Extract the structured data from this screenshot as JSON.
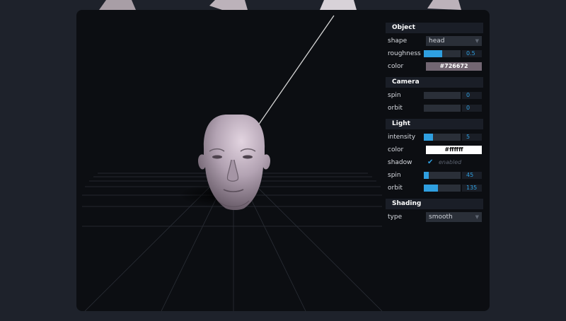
{
  "panel": {
    "object": {
      "title": "Object",
      "shape_label": "shape",
      "shape_value": "head",
      "roughness_label": "roughness",
      "roughness_value": "0.5",
      "roughness_fraction": 0.5,
      "color_label": "color",
      "color_value": "#726672"
    },
    "camera": {
      "title": "Camera",
      "spin_label": "spin",
      "spin_value": "0",
      "spin_fraction": 0,
      "orbit_label": "orbit",
      "orbit_value": "0",
      "orbit_fraction": 0
    },
    "light": {
      "title": "Light",
      "intensity_label": "intensity",
      "intensity_value": "5",
      "intensity_fraction": 0.25,
      "color_label": "color",
      "color_value": "#ffffff",
      "shadow_label": "shadow",
      "shadow_state": "enabled",
      "spin_label": "spin",
      "spin_value": "45",
      "spin_fraction": 0.125,
      "orbit_label": "orbit",
      "orbit_value": "135",
      "orbit_fraction": 0.375
    },
    "shading": {
      "title": "Shading",
      "type_label": "type",
      "type_value": "smooth"
    }
  },
  "colors": {
    "accent": "#2f9fe0",
    "background": "#1e222b",
    "canvas": "#0c0e12",
    "object_color": "#726672",
    "light_color": "#ffffff"
  },
  "icons": {
    "select_arrow": "chevron-down-icon",
    "checkbox": "checkmark-icon"
  }
}
